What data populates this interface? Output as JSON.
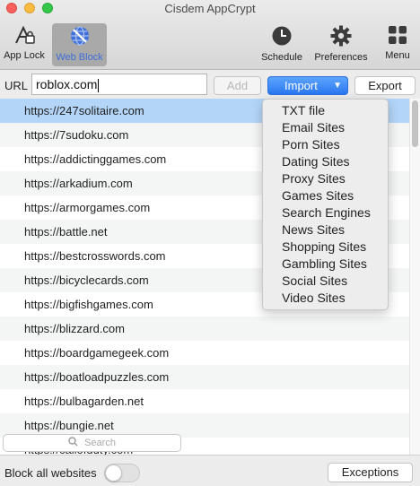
{
  "window": {
    "title": "Cisdem AppCrypt"
  },
  "toolbar": {
    "app_lock": "App Lock",
    "web_block": "Web Block",
    "schedule": "Schedule",
    "preferences": "Preferences",
    "menu": "Menu"
  },
  "urlbar": {
    "label": "URL",
    "value": "roblox.com",
    "add": "Add",
    "import": "Import",
    "export": "Export"
  },
  "sites": [
    "https://247solitaire.com",
    "https://7sudoku.com",
    "https://addictinggames.com",
    "https://arkadium.com",
    "https://armorgames.com",
    "https://battle.net",
    "https://bestcrosswords.com",
    "https://bicyclecards.com",
    "https://bigfishgames.com",
    "https://blizzard.com",
    "https://boardgamegeek.com",
    "https://boatloadpuzzles.com",
    "https://bulbagarden.net",
    "https://bungie.net",
    "https://callofduty.com"
  ],
  "import_menu": [
    "TXT file",
    "Email Sites",
    "Porn Sites",
    "Dating Sites",
    "Proxy Sites",
    "Games Sites",
    "Search Engines",
    "News Sites",
    "Shopping Sites",
    "Gambling Sites",
    "Social Sites",
    "Video Sites"
  ],
  "search": {
    "placeholder": "Search"
  },
  "footer": {
    "block_all": "Block all websites",
    "block_all_on": false,
    "exceptions": "Exceptions"
  },
  "icons": {
    "app_lock": "app-lock-icon",
    "web_block": "globe-block-icon",
    "schedule": "clock-icon",
    "preferences": "gear-icon",
    "menu": "grid-icon",
    "search": "magnifier-icon",
    "dropdown": "chevron-down-icon"
  },
  "colors": {
    "accent": "#2a78f0",
    "selection": "#b3d5f8",
    "active_tool": "#3f6fd8"
  }
}
